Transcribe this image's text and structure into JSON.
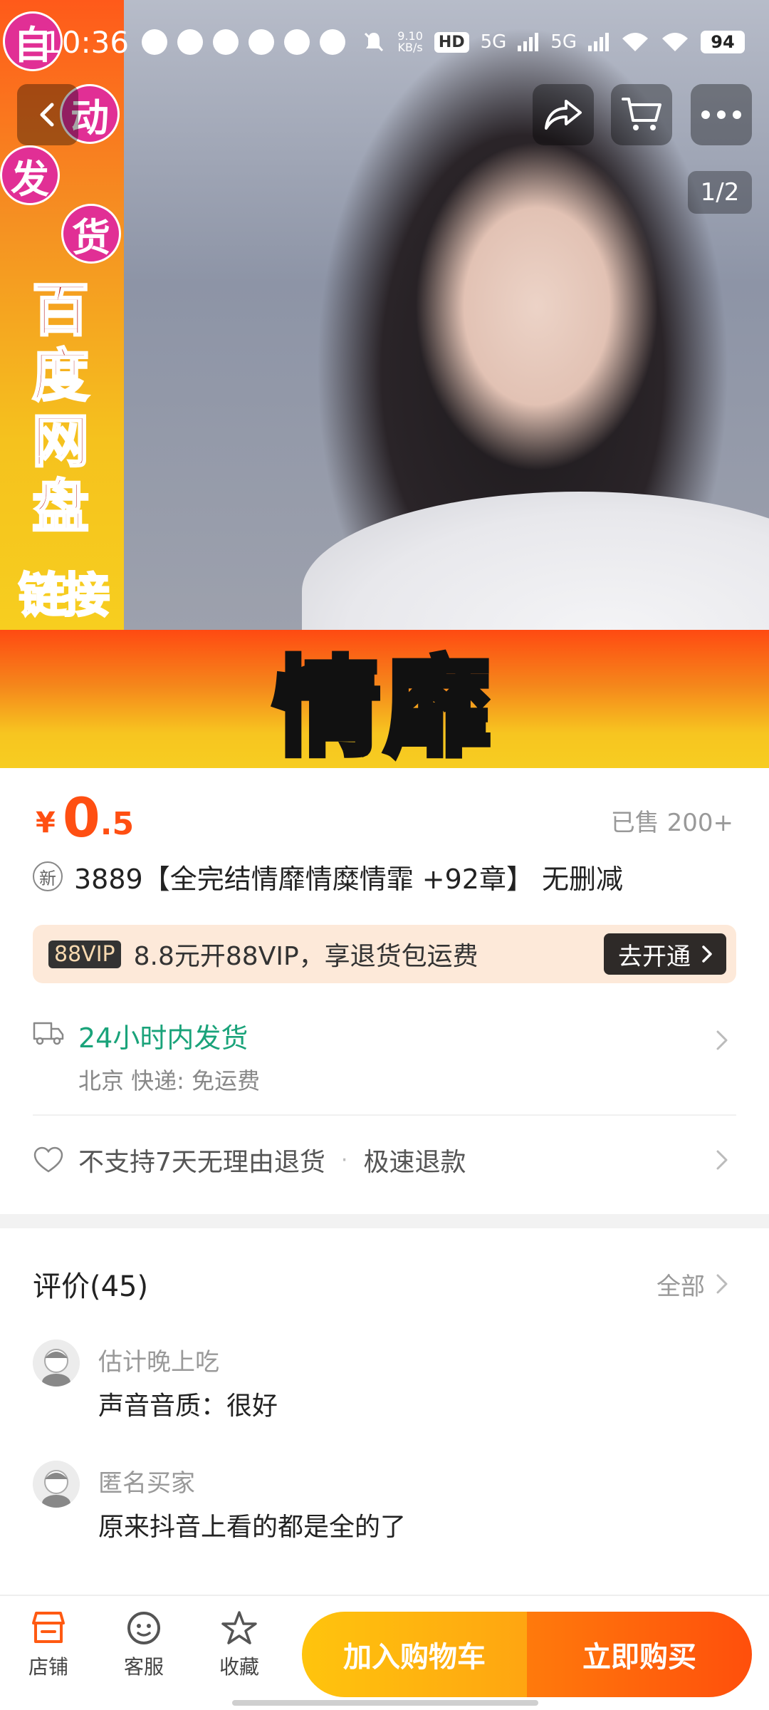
{
  "status_bar": {
    "time": "10:36",
    "net_speed_value": "9.10",
    "net_speed_unit": "KB/s",
    "hd_label": "HD",
    "signal1": "5G",
    "signal2": "5G",
    "battery": "94"
  },
  "hero": {
    "badges": [
      "自",
      "动",
      "发",
      "货"
    ],
    "vertical_title": [
      "百",
      "度",
      "网",
      "盘"
    ],
    "vertical_link": "链接",
    "banner_text": "情靡",
    "page_indicator": "1/2"
  },
  "product": {
    "currency": "¥",
    "price_int": "0",
    "price_dec": ".5",
    "sold": "已售 200+",
    "new_tag": "新",
    "title": "3889【全完结情靡情糜情霏 +92章】 无删减"
  },
  "vip": {
    "logo": "88VIP",
    "text": "8.8元开88VIP，享退货包运费",
    "button": "去开通"
  },
  "shipping": {
    "title": "24小时内发货",
    "subtitle": "北京  快递: 免运费"
  },
  "returns": {
    "policy": "不支持7天无理由退货",
    "separator": "·",
    "refund": "极速退款"
  },
  "reviews": {
    "title": "评价(45)",
    "all_label": "全部",
    "items": [
      {
        "user": "估计晚上吃",
        "text": "声音音质：很好"
      },
      {
        "user": "匿名买家",
        "text": "原来抖音上看的都是全的了"
      }
    ]
  },
  "bottom_bar": {
    "tabs": [
      "店铺",
      "客服",
      "收藏"
    ],
    "add_to_cart": "加入购物车",
    "buy_now": "立即购买"
  },
  "colors": {
    "price": "#ff4f12",
    "shipping_green": "#1aa37a",
    "cart_yellow": "#ffc40d",
    "buy_orange": "#ff4f0c"
  }
}
